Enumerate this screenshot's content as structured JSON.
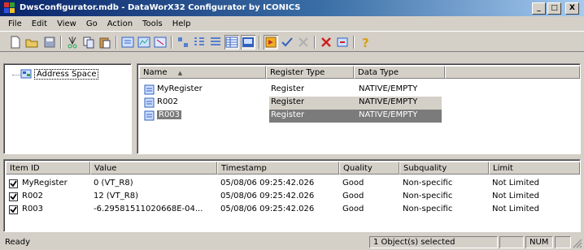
{
  "window": {
    "title": "DwsConfigurator.mdb - DataWorX32 Configurator by ICONICS",
    "minimize_label": "_",
    "maximize_label": "□",
    "close_label": "X"
  },
  "menu": [
    "File",
    "Edit",
    "View",
    "Go",
    "Action",
    "Tools",
    "Help"
  ],
  "toolbar": {
    "icons": [
      "new-icon",
      "open-icon",
      "save-icon",
      "cut-icon",
      "copy-icon",
      "paste-icon",
      "add-register-icon",
      "add-server-icon",
      "properties-icon",
      "large-icons-icon",
      "small-icons-icon",
      "list-view-icon",
      "details-view-icon",
      "start-icon",
      "check-icon",
      "stop-icon",
      "delete-icon",
      "refresh-icon",
      "help-icon"
    ]
  },
  "tree": {
    "root_label": "Address Space"
  },
  "registers": {
    "columns": [
      "Name",
      "Register Type",
      "Data Type"
    ],
    "sort_indicator": "▲",
    "rows": [
      {
        "name": "MyRegister",
        "type": "Register",
        "data_type": "NATIVE/EMPTY",
        "state": "normal"
      },
      {
        "name": "R002",
        "type": "Register",
        "data_type": "NATIVE/EMPTY",
        "state": "inactive-selected"
      },
      {
        "name": "R003",
        "type": "Register",
        "data_type": "NATIVE/EMPTY",
        "state": "selected"
      }
    ]
  },
  "items": {
    "columns": [
      "Item ID",
      "Value",
      "Timestamp",
      "Quality",
      "Subquality",
      "Limit"
    ],
    "rows": [
      {
        "id": "MyRegister",
        "value": "0 (VT_R8)",
        "timestamp": "05/08/06 09:25:42.026",
        "quality": "Good",
        "subquality": "Non-specific",
        "limit": "Not Limited",
        "checked": true
      },
      {
        "id": "R002",
        "value": "12 (VT_R8)",
        "timestamp": "05/08/06 09:25:42.026",
        "quality": "Good",
        "subquality": "Non-specific",
        "limit": "Not Limited",
        "checked": true
      },
      {
        "id": "R003",
        "value": "-6.29581511020668E-04...",
        "timestamp": "05/08/06 09:25:42.026",
        "quality": "Good",
        "subquality": "Non-specific",
        "limit": "Not Limited",
        "checked": true
      }
    ]
  },
  "status": {
    "left": "Ready",
    "selection": "1 Object(s) selected",
    "num": "NUM"
  },
  "colors": {
    "title_start": "#0a246a",
    "title_end": "#a6caf0",
    "selection": "#7b7b7b",
    "inactive_selection": "#d4d0c8",
    "chrome": "#d4d0c8"
  }
}
